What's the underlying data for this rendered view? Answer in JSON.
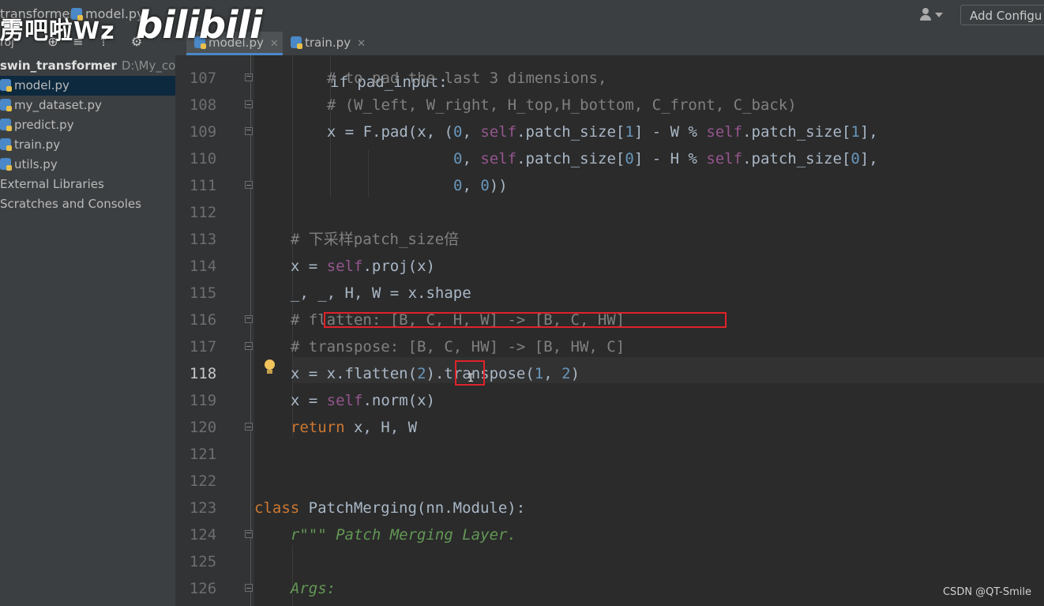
{
  "watermark": {
    "text": "雳吧啦Wz",
    "logo": "bilibili"
  },
  "breadcrumb": {
    "project": "transformer",
    "file": "model.py"
  },
  "toolbar": {
    "add_config": "Add Configu",
    "project_label": "roj"
  },
  "tabs": [
    {
      "label": "model.py",
      "active": true
    },
    {
      "label": "train.py",
      "active": false
    }
  ],
  "project_tree": {
    "root": "swin_transformer",
    "root_path": "D:\\My_code",
    "files": [
      "model.py",
      "my_dataset.py",
      "predict.py",
      "train.py",
      "utils.py"
    ],
    "extras": [
      "External Libraries",
      "Scratches and Consoles"
    ]
  },
  "editor": {
    "top_partial": "if pad_input:",
    "current_line": "118",
    "lines": [
      {
        "num": "107",
        "segs": [
          [
            "cm",
            "# to pad the last 3 dimensions,"
          ]
        ]
      },
      {
        "num": "108",
        "segs": [
          [
            "cm",
            "# (W_left, W_right, H_top,H_bottom, C_front, C_back)"
          ]
        ]
      },
      {
        "num": "109",
        "segs": [
          [
            "t",
            "x = F.pad(x, ("
          ],
          [
            "num",
            "0"
          ],
          [
            "t",
            ", "
          ],
          [
            "self",
            "self"
          ],
          [
            "t",
            ".patch_size["
          ],
          [
            "num",
            "1"
          ],
          [
            "t",
            "] - W % "
          ],
          [
            "self",
            "self"
          ],
          [
            "t",
            ".patch_size["
          ],
          [
            "num",
            "1"
          ],
          [
            "t",
            "],"
          ]
        ]
      },
      {
        "num": "110",
        "segs": [
          [
            "t",
            "              "
          ],
          [
            "num",
            "0"
          ],
          [
            "t",
            ", "
          ],
          [
            "self",
            "self"
          ],
          [
            "t",
            ".patch_size["
          ],
          [
            "num",
            "0"
          ],
          [
            "t",
            "] - H % "
          ],
          [
            "self",
            "self"
          ],
          [
            "t",
            ".patch_size["
          ],
          [
            "num",
            "0"
          ],
          [
            "t",
            "],"
          ]
        ]
      },
      {
        "num": "111",
        "segs": [
          [
            "t",
            "              "
          ],
          [
            "num",
            "0"
          ],
          [
            "t",
            ", "
          ],
          [
            "num",
            "0"
          ],
          [
            "t",
            "))"
          ]
        ]
      },
      {
        "num": "112",
        "segs": []
      },
      {
        "num": "113",
        "segs": [
          [
            "cm",
            "# 下采样patch_size倍"
          ]
        ]
      },
      {
        "num": "114",
        "segs": [
          [
            "t",
            "x = "
          ],
          [
            "self",
            "self"
          ],
          [
            "t",
            ".proj(x)"
          ]
        ]
      },
      {
        "num": "115",
        "segs": [
          [
            "t",
            "_, _, H, W = x.shape"
          ]
        ]
      },
      {
        "num": "116",
        "segs": [
          [
            "cm",
            "# flatten: [B, C, H, W] -> [B, C, HW]"
          ]
        ]
      },
      {
        "num": "117",
        "segs": [
          [
            "cm",
            "# transpose: [B, C, HW] -> [B, HW, C]"
          ]
        ]
      },
      {
        "num": "118",
        "segs": [
          [
            "t",
            "x = x.flatten("
          ],
          [
            "num",
            "2"
          ],
          [
            "t",
            ").transpose("
          ],
          [
            "num",
            "1"
          ],
          [
            "t",
            ", "
          ],
          [
            "num",
            "2"
          ],
          [
            "t",
            ")"
          ]
        ]
      },
      {
        "num": "119",
        "segs": [
          [
            "t",
            "x = "
          ],
          [
            "self",
            "self"
          ],
          [
            "t",
            ".norm(x)"
          ]
        ]
      },
      {
        "num": "120",
        "segs": [
          [
            "kw",
            "return "
          ],
          [
            "t",
            "x, H, W"
          ]
        ]
      },
      {
        "num": "121",
        "segs": []
      },
      {
        "num": "122",
        "segs": []
      },
      {
        "num": "123",
        "segs": [
          [
            "kw",
            "class "
          ],
          [
            "t",
            "PatchMerging(nn.Module):"
          ]
        ]
      },
      {
        "num": "124",
        "segs": [
          [
            "doc",
            "r\"\"\" Patch Merging Layer."
          ]
        ]
      },
      {
        "num": "125",
        "segs": []
      },
      {
        "num": "126",
        "segs": [
          [
            "doc",
            "Args:"
          ]
        ]
      }
    ]
  },
  "footer": {
    "csdn": "CSDN @QT-Smile"
  }
}
